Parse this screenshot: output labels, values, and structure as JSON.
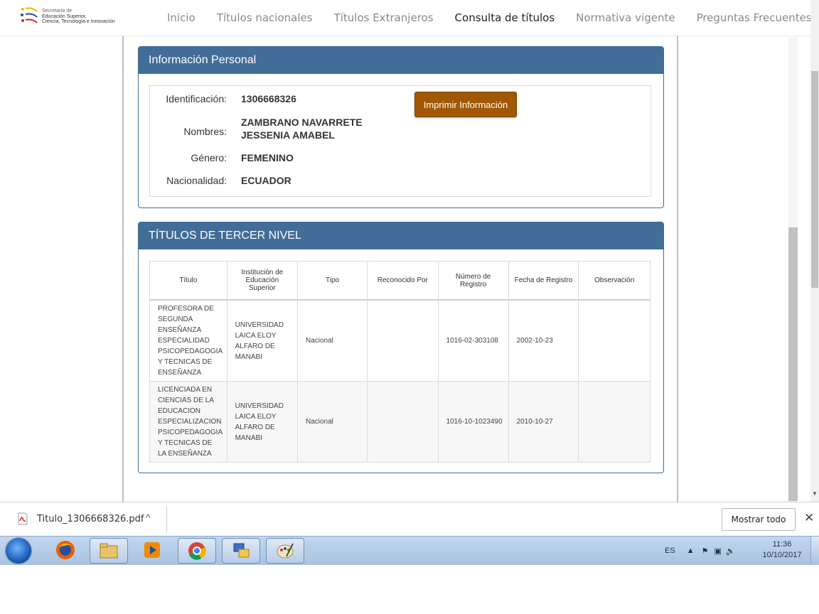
{
  "logo": {
    "line1": "Secretaría de",
    "line2": "Educación Superior,",
    "line3": "Ciencia, Tecnología e Innovación"
  },
  "nav": {
    "items": [
      "Inicio",
      "Títulos nacionales",
      "Títulos Extranjeros",
      "Consulta de títulos",
      "Normativa vigente",
      "Preguntas Frecuentes"
    ],
    "active": "Consulta de títulos"
  },
  "personal": {
    "title": "Información Personal",
    "print_button": "Imprimir Información",
    "id_label": "Identificación:",
    "id_value": "1306668326",
    "names_label": "Nombres:",
    "names_line1": "ZAMBRANO NAVARRETE",
    "names_line2": "JESSENIA AMABEL",
    "gender_label": "Género:",
    "gender_value": "FEMENINO",
    "nationality_label": "Nacionalidad:",
    "nationality_value": "ECUADOR"
  },
  "titles": {
    "title": "TÍTULOS DE TERCER NIVEL",
    "headers": [
      "Título",
      "Institución de Educación Superior",
      "Tipo",
      "Reconocido Por",
      "Número de Registro",
      "Fecha de Registro",
      "Observación"
    ],
    "rows": [
      {
        "titulo": "PROFESORA DE SEGUNDA ENSEÑANZA ESPECIALIDAD PSICOPEDAGOGIA Y TECNICAS DE ENSEÑANZA",
        "institucion": "UNIVERSIDAD LAICA ELOY ALFARO DE MANABI",
        "tipo": "Nacional",
        "reconocido": "",
        "numero": "1016-02-303108",
        "fecha": "2002-10-23",
        "observacion": ""
      },
      {
        "titulo": "LICENCIADA EN CIENCIAS DE LA EDUCACION ESPECIALIZACION PSICOPEDAGOGIA Y TECNICAS DE LA ENSEÑANZA",
        "institucion": "UNIVERSIDAD LAICA ELOY ALFARO DE MANABI",
        "tipo": "Nacional",
        "reconocido": "",
        "numero": "1016-10-1023490",
        "fecha": "2010-10-27",
        "observacion": ""
      }
    ]
  },
  "download_bar": {
    "file_name": "Titulo_1306668326.pdf",
    "show_all": "Mostrar todo"
  },
  "taskbar": {
    "lang": "ES",
    "time": "11:36",
    "date": "10/10/2017"
  },
  "colors": {
    "panel_header": "#426d99",
    "print_button": "#a15800"
  }
}
